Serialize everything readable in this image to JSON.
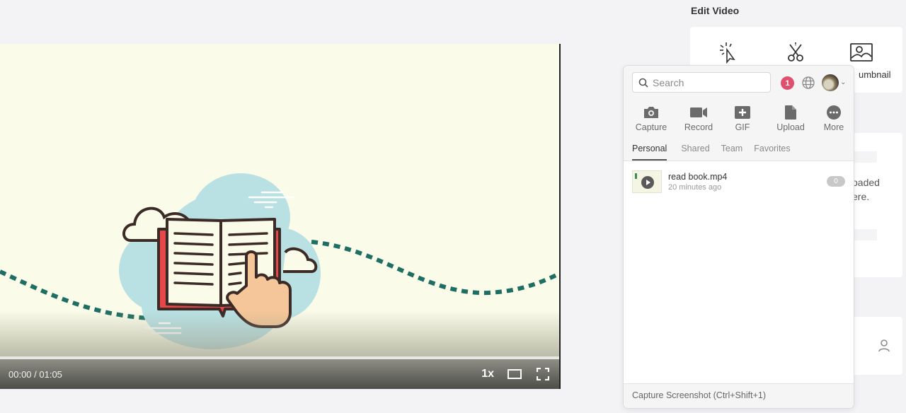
{
  "video": {
    "time_display": "00:00 / 01:05",
    "current_time": "00:00",
    "duration": "01:05",
    "progress_fraction": 0,
    "speed_label": "1x",
    "colors": {
      "background": "#fafce9",
      "path": "#1e6e63",
      "cloud": "#b9e1e3",
      "book_cover": "#e6474a",
      "outline": "#3b2a26",
      "hand": "#f4c699"
    }
  },
  "edit_panel": {
    "title": "Edit Video",
    "tools": [
      {
        "icon": "click-cursor-icon",
        "label": ""
      },
      {
        "icon": "scissors-icon",
        "label": ""
      },
      {
        "icon": "image-icon",
        "label": "umbnail"
      }
    ],
    "info_text_line1": "oaded",
    "info_text_line2": "ere.",
    "user_icon": "person-icon"
  },
  "popup": {
    "search": {
      "placeholder": "Search",
      "value": ""
    },
    "notification_count": "1",
    "globe_icon": "globe-icon",
    "actions": [
      {
        "icon": "camera-icon",
        "label": "Capture"
      },
      {
        "icon": "video-camera-icon",
        "label": "Record"
      },
      {
        "icon": "gif-plus-icon",
        "label": "GIF"
      },
      {
        "icon": "file-icon",
        "label": "Upload"
      },
      {
        "icon": "more-dots-icon",
        "label": "More"
      }
    ],
    "tabs": [
      {
        "label": "Personal",
        "active": true
      },
      {
        "label": "Shared",
        "active": false
      },
      {
        "label": "Team",
        "active": false
      },
      {
        "label": "Favorites",
        "active": false
      }
    ],
    "items": [
      {
        "name": "read book.mp4",
        "time": "20 minutes ago",
        "count": "0"
      }
    ],
    "footer": "Capture Screenshot (Ctrl+Shift+1)",
    "accent_colors": {
      "notification": "#e0506e",
      "icon_gray": "#6b6b6b"
    }
  }
}
